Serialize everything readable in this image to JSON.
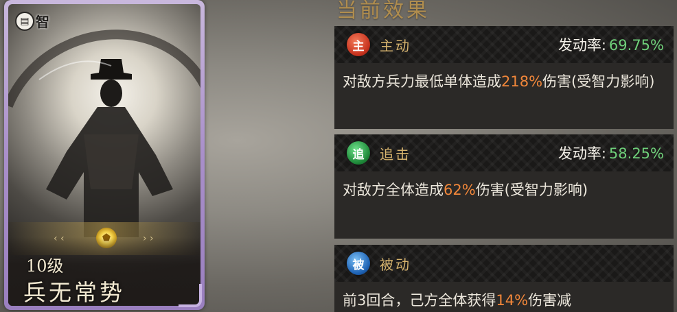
{
  "card": {
    "type_icon": "book-icon",
    "type_label": "智",
    "level": "10级",
    "skill_name": "兵无常势",
    "frame_color": "#a98fca"
  },
  "panel": {
    "title": "当前效果"
  },
  "effects": [
    {
      "icon": "主",
      "icon_color": "#c8331e",
      "type": "主动",
      "rate_label": "发动率:",
      "rate_value": "69.75%",
      "desc_before": "对敌方兵力最低单体造成",
      "desc_highlight": "218%",
      "desc_after": "伤害(受智力影响)"
    },
    {
      "icon": "追",
      "icon_color": "#1f8a3a",
      "type": "追击",
      "rate_label": "发动率:",
      "rate_value": "58.25%",
      "desc_before": "对敌方全体造成",
      "desc_highlight": "62%",
      "desc_after": "伤害(受智力影响)"
    },
    {
      "icon": "被",
      "icon_color": "#1e63b5",
      "type": "被动",
      "desc_before": "前3回合，己方全体获得",
      "desc_highlight": "14%",
      "desc_after": "伤害减"
    }
  ],
  "colors": {
    "highlight": "#f2873a",
    "rate": "#6fd07a",
    "title": "#b08d4e"
  }
}
